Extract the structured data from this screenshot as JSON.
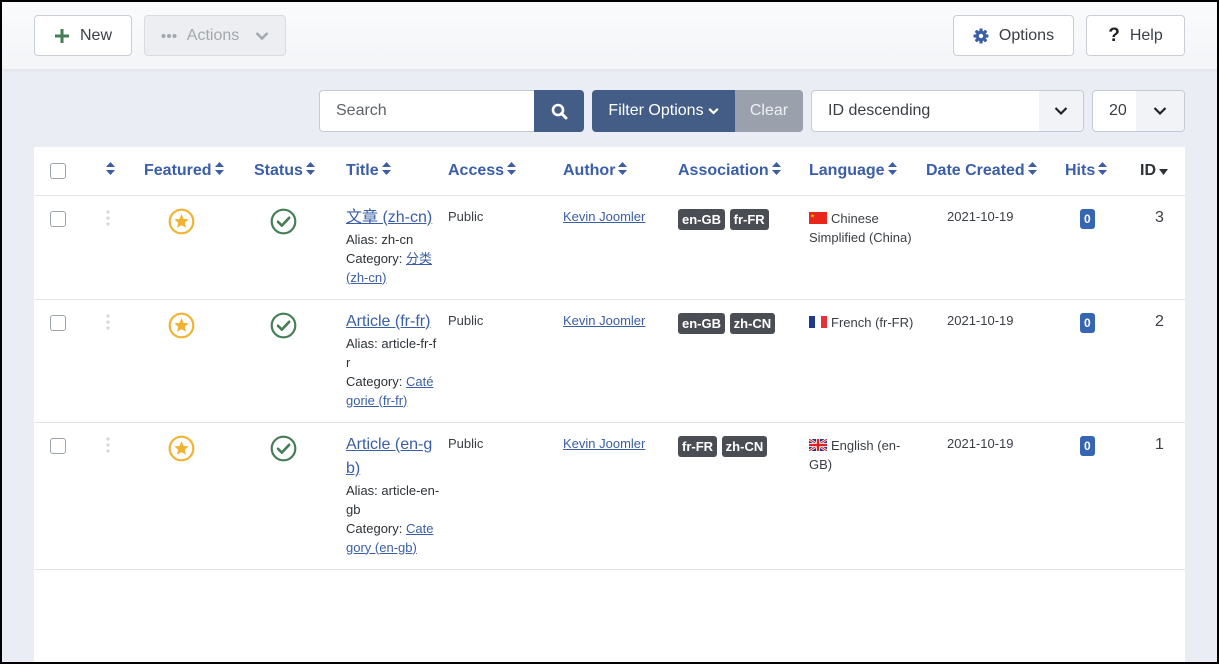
{
  "toolbar": {
    "new_label": "New",
    "actions_label": "Actions",
    "options_label": "Options",
    "help_label": "Help"
  },
  "filters": {
    "search_placeholder": "Search",
    "search_value": "",
    "filter_options_label": "Filter Options",
    "clear_label": "Clear",
    "sort_value": "ID descending",
    "limit_value": "20"
  },
  "colors": {
    "primary": "#435d87",
    "link": "#3a5ea7",
    "featured": "#f0b232",
    "published": "#457d54",
    "badge_dark": "#4a4e54",
    "hits_badge": "#3565b3"
  },
  "table": {
    "columns": {
      "featured": "Featured",
      "status": "Status",
      "title": "Title",
      "access": "Access",
      "author": "Author",
      "association": "Association",
      "language": "Language",
      "date_created": "Date Created",
      "hits": "Hits",
      "id": "ID"
    },
    "rows": [
      {
        "title": "文章 (zh-cn)",
        "alias": "Alias: zh-cn",
        "category_label": "Category:",
        "category": "分类 (zh-cn)",
        "access": "Public",
        "author": "Kevin Joomler",
        "associations": [
          "en-GB",
          "fr-FR"
        ],
        "language": "Chinese Simplified (China)",
        "flag": "cn-flag",
        "date_created": "2021-10-19",
        "hits": "0",
        "id": "3",
        "featured": true,
        "status": "published"
      },
      {
        "title": "Article (fr-fr)",
        "alias": "Alias: article-fr-fr",
        "category_label": "Category:",
        "category": "Catégorie (fr-fr)",
        "access": "Public",
        "author": "Kevin Joomler",
        "associations": [
          "en-GB",
          "zh-CN"
        ],
        "language": "French (fr-FR)",
        "flag": "fr-flag",
        "date_created": "2021-10-19",
        "hits": "0",
        "id": "2",
        "featured": true,
        "status": "published"
      },
      {
        "title": "Article (en-gb)",
        "alias": "Alias: article-en-gb",
        "category_label": "Category:",
        "category": "Category (en-gb)",
        "access": "Public",
        "author": "Kevin Joomler",
        "associations": [
          "fr-FR",
          "zh-CN"
        ],
        "language": "English (en-GB)",
        "flag": "gb-flag",
        "date_created": "2021-10-19",
        "hits": "0",
        "id": "1",
        "featured": true,
        "status": "published"
      }
    ]
  }
}
